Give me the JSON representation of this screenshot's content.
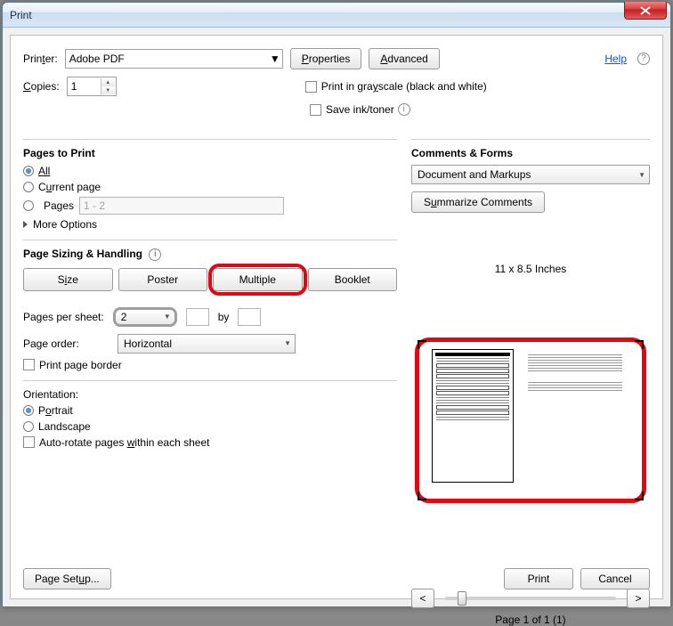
{
  "window": {
    "title": "Print"
  },
  "top": {
    "printer_label_pre": "Prin",
    "printer_label_u": "t",
    "printer_label_post": "er:",
    "printer_value": "Adobe PDF",
    "properties_u": "P",
    "properties_rest": "roperties",
    "advanced_u": "A",
    "advanced_rest": "dvanced",
    "help": "Help",
    "copies_u": "C",
    "copies_rest": "opies:",
    "copies_value": "1",
    "grayscale_pre": "Print in gra",
    "grayscale_u": "y",
    "grayscale_post": "scale (black and white)",
    "saveink": "Save ink/toner"
  },
  "pages": {
    "header": "Pages to Print",
    "all": "All",
    "current_pre": "C",
    "current_u": "u",
    "current_post": "rrent page",
    "pages": "Pages",
    "range_placeholder": "1 - 2",
    "more": "More Options"
  },
  "sizing": {
    "header": "Page Sizing & Handling",
    "tab_size_pre": "S",
    "tab_size_u": "i",
    "tab_size_post": "ze",
    "tab_poster": "Poster",
    "tab_multiple": "Multiple",
    "tab_booklet": "Booklet",
    "pps_label": "Pages per sheet:",
    "pps_value": "2",
    "by": "by",
    "order_label": "Page order:",
    "order_value": "Horizontal",
    "border": "Print page border"
  },
  "orientation": {
    "header": "Orientation:",
    "portrait_pre": "P",
    "portrait_u": "o",
    "portrait_post": "rtrait",
    "landscape": "Landscape",
    "autorotate_pre": "Auto-rotate pages ",
    "autorotate_u": "w",
    "autorotate_post": "ithin each sheet"
  },
  "comments": {
    "header": "Comments & Forms",
    "value": "Document and Markups",
    "summarize_pre": "S",
    "summarize_u": "u",
    "summarize_post": "mmarize Comments"
  },
  "preview": {
    "dims": "11 x 8.5 Inches",
    "page_of": "Page 1 of 1 (1)"
  },
  "footer": {
    "page_setup_pre": "Page Set",
    "page_setup_u": "u",
    "page_setup_post": "p...",
    "print": "Print",
    "cancel": "Cancel"
  }
}
